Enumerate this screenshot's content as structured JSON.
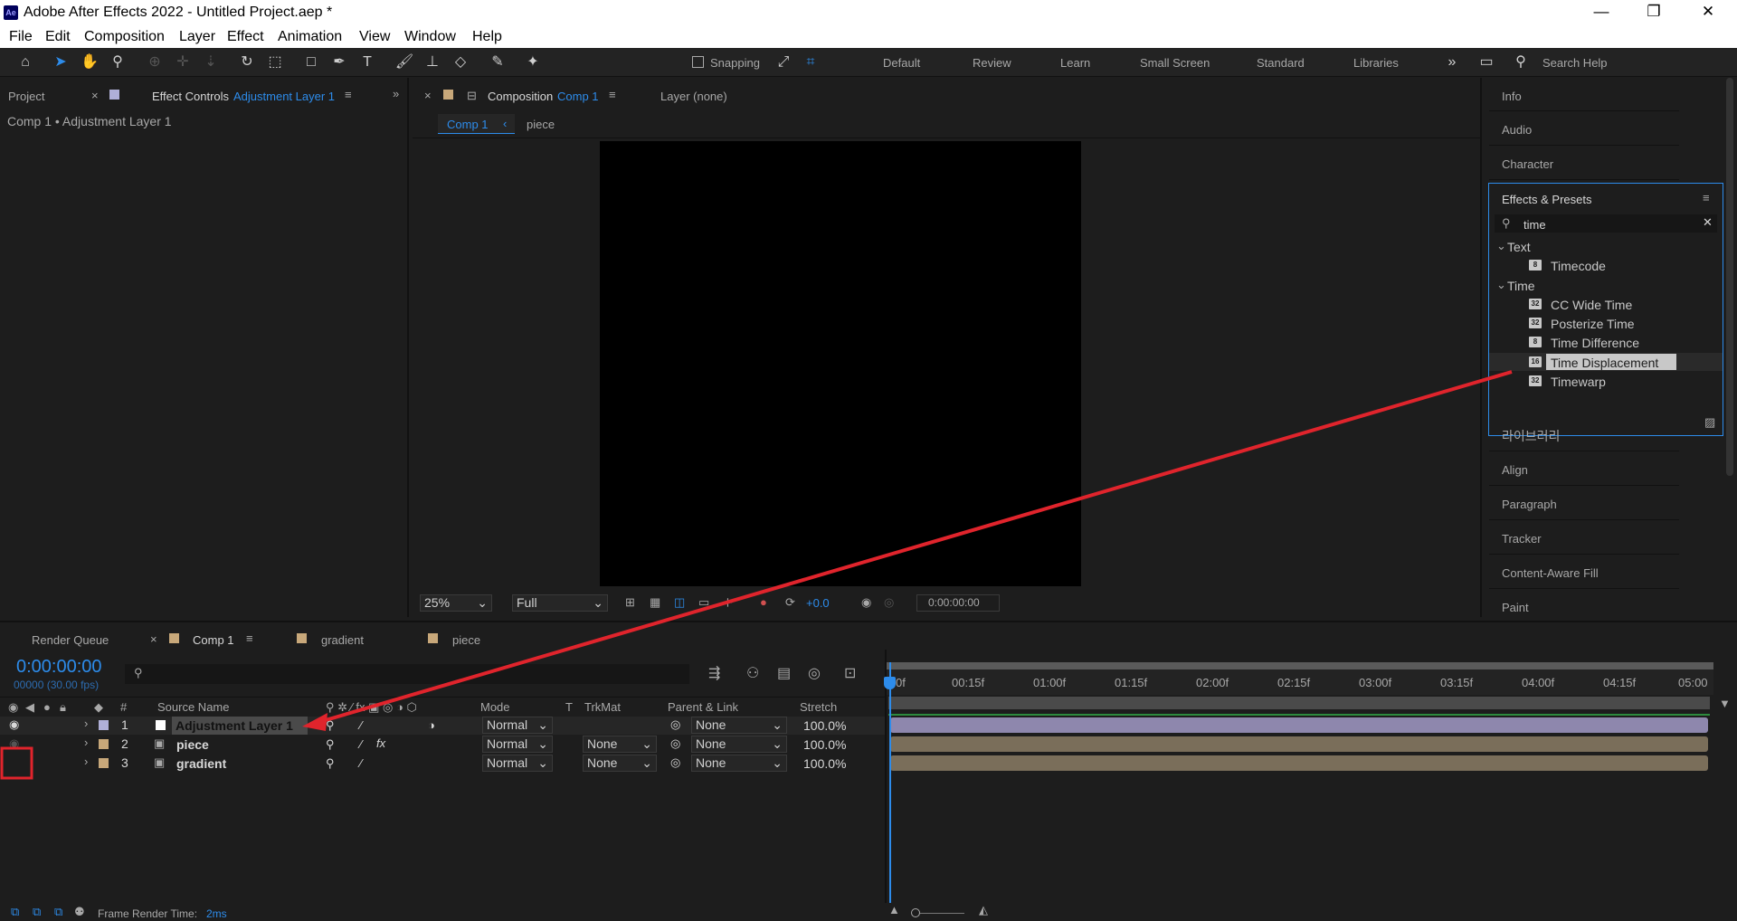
{
  "window": {
    "title": "Adobe After Effects 2022 - Untitled Project.aep *",
    "logo": "Ae"
  },
  "menu": [
    "File",
    "Edit",
    "Composition",
    "Layer",
    "Effect",
    "Animation",
    "View",
    "Window",
    "Help"
  ],
  "toolbar": {
    "snapping_label": "Snapping",
    "workspaces": [
      "Default",
      "Review",
      "Learn",
      "Small Screen",
      "Standard",
      "Libraries"
    ],
    "search_placeholder": "Search Help"
  },
  "left_panel": {
    "project_tab": "Project",
    "effect_controls_tab": "Effect Controls",
    "effect_controls_layer": "Adjustment Layer 1",
    "breadcrumb": "Comp 1 • Adjustment Layer 1"
  },
  "comp_panel": {
    "tab_label": "Composition",
    "tab_comp": "Comp 1",
    "layer_tab": "Layer (none)",
    "flow": [
      "Comp 1",
      "piece"
    ],
    "zoom": "25%",
    "resolution": "Full",
    "exposure": "+0.0",
    "timecode": "0:00:00:00"
  },
  "right_panel": {
    "info": "Info",
    "audio": "Audio",
    "character": "Character",
    "effects_presets": "Effects & Presets",
    "search_value": "time",
    "groups": [
      {
        "name": "Text",
        "items": [
          {
            "label": "Timecode",
            "bpc": "8"
          }
        ]
      },
      {
        "name": "Time",
        "items": [
          {
            "label": "CC Wide Time",
            "bpc": "32"
          },
          {
            "label": "Posterize Time",
            "bpc": "32"
          },
          {
            "label": "Time Difference",
            "bpc": "8"
          },
          {
            "label": "Time Displacement",
            "bpc": "16"
          },
          {
            "label": "Timewarp",
            "bpc": "32"
          }
        ]
      }
    ],
    "lower": [
      "라이브러리",
      "Align",
      "Paragraph",
      "Tracker",
      "Content-Aware Fill",
      "Paint"
    ]
  },
  "timeline": {
    "tabs": [
      "Render Queue",
      "Comp 1",
      "gradient",
      "piece"
    ],
    "timecode": "0:00:00:00",
    "frames": "00000 (30.00 fps)",
    "headers": {
      "num": "#",
      "source": "Source Name",
      "mode": "Mode",
      "t": "T",
      "trkmat": "TrkMat",
      "parent": "Parent & Link",
      "stretch": "Stretch"
    },
    "layers": [
      {
        "num": "1",
        "name": "Adjustment Layer 1",
        "mode": "Normal",
        "trkmat": "",
        "parent": "None",
        "stretch": "100.0%",
        "color": "#b0b0d8"
      },
      {
        "num": "2",
        "name": "piece",
        "mode": "Normal",
        "trkmat": "None",
        "parent": "None",
        "stretch": "100.0%",
        "color": "#c8a87a"
      },
      {
        "num": "3",
        "name": "gradient",
        "mode": "Normal",
        "trkmat": "None",
        "parent": "None",
        "stretch": "100.0%",
        "color": "#c8a87a"
      }
    ],
    "ruler": [
      "0f",
      "00:15f",
      "01:00f",
      "01:15f",
      "02:00f",
      "02:15f",
      "03:00f",
      "03:15f",
      "04:00f",
      "04:15f",
      "05:00"
    ],
    "status": "Frame Render Time:",
    "render_time": "2ms"
  },
  "colors": {
    "accent": "#2d8ceb",
    "annotation": "#e0242c",
    "adjust_bar": "#8e87ad",
    "footage_bar": "#7a6e5a"
  }
}
